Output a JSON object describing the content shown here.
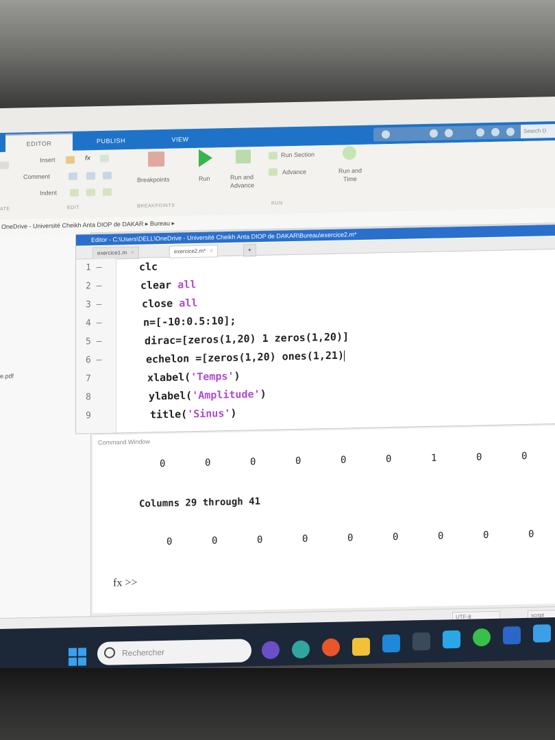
{
  "ribbon": {
    "tabs": [
      "EDITOR",
      "PUBLISH",
      "VIEW"
    ],
    "search_placeholder": "Search D",
    "edit": {
      "insert": "Insert",
      "comment": "Comment",
      "indent": "Indent",
      "fx": "fx",
      "section_label": "EDIT"
    },
    "breakpoints": {
      "label": "Breakpoints",
      "section_label": "BREAKPOINTS"
    },
    "run": {
      "run": "Run",
      "run_and_advance": "Run and Advance",
      "run_section": "Run Section",
      "advance": "Advance",
      "run_and_time": "Run and Time",
      "section_label": "RUN"
    },
    "left_section_label": "ATE"
  },
  "path": {
    "text": "OneDrive - Université Cheikh Anta DIOP de DAKAR ▸ Bureau ▸"
  },
  "left_panel": {
    "file": "e.pdf"
  },
  "editor": {
    "title": "Editor - C:\\Users\\DELL\\OneDrive - Université Cheikh Anta DIOP de DAKAR\\Bureau\\exercice2.m*",
    "tabs": [
      {
        "label": "exercice1.m",
        "close": "×"
      },
      {
        "label": "exercice2.m*",
        "close": "×"
      }
    ],
    "new_tab": "+",
    "lines": [
      {
        "n": "1 –",
        "pre": "clc",
        "kw": "",
        "post": ""
      },
      {
        "n": "2 –",
        "pre": "clear ",
        "kw": "all",
        "post": ""
      },
      {
        "n": "3 –",
        "pre": "close ",
        "kw": "all",
        "post": ""
      },
      {
        "n": "4 –",
        "pre": "n=[-10:0.5:10];",
        "kw": "",
        "post": ""
      },
      {
        "n": "5 –",
        "pre": "dirac=[zeros(1,20) 1 zeros(1,20)]",
        "kw": "",
        "post": ""
      },
      {
        "n": "6 –",
        "pre": "echelon =[zeros(1,20) ones(1,21)",
        "kw": "",
        "post": ""
      },
      {
        "n": "7",
        "pre": "xlabel(",
        "kw": "'Temps'",
        "post": ")"
      },
      {
        "n": "8",
        "pre": "ylabel(",
        "kw": "'Amplitude'",
        "post": ")"
      },
      {
        "n": "9",
        "pre": "title(",
        "kw": "'Sinus'",
        "post": ")"
      }
    ]
  },
  "command_window": {
    "title": "Command Window",
    "row1": [
      "0",
      "0",
      "0",
      "0",
      "0",
      "0",
      "1",
      "0",
      "0"
    ],
    "heading": "Columns 29 through 41",
    "row2": [
      "0",
      "0",
      "0",
      "0",
      "0",
      "0",
      "0",
      "0",
      "0"
    ],
    "prompt": "fx >>"
  },
  "status": {
    "encoding": "UTF-8",
    "type": "script"
  },
  "taskbar": {
    "search_placeholder": "Rechercher"
  },
  "colors": {
    "ribbon_blue": "#1e73c8",
    "editor_title": "#2a6fcb",
    "keyword": "#b04ad0",
    "run_green": "#38b54a"
  }
}
